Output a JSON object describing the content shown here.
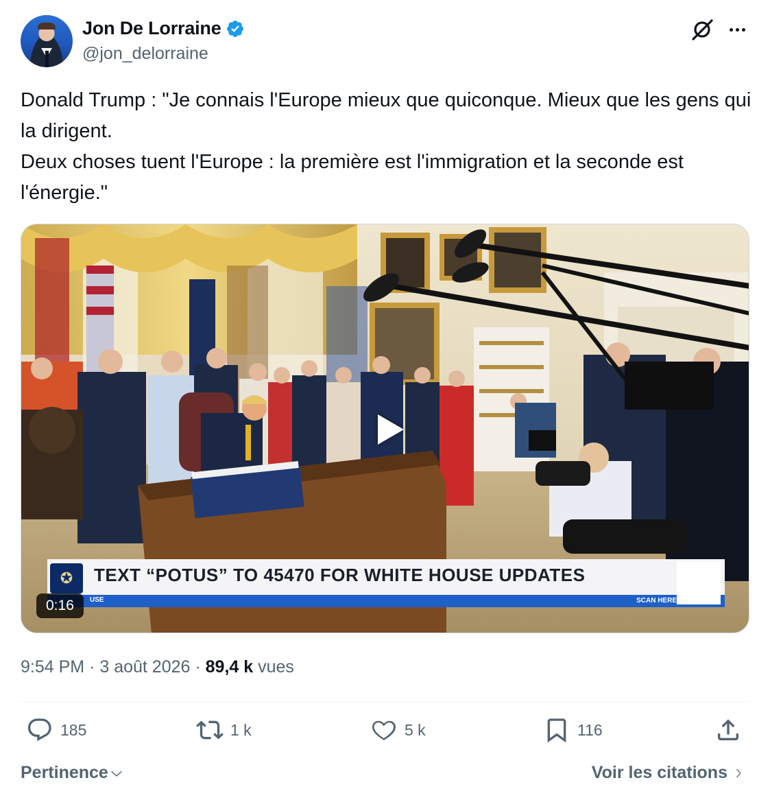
{
  "author": {
    "display_name": "Jon De Lorraine",
    "handle": "@jon_delorraine",
    "verified": true
  },
  "tweet": {
    "text": "Donald Trump : \"Je connais l'Europe mieux que quiconque. Mieux que les gens qui la dirigent.\nDeux choses tuent l'Europe : la première est l'immigration et la seconde est l'énergie.\""
  },
  "media": {
    "type": "video",
    "duration": "0:16",
    "chyron_text": "TEXT “POTUS” TO 45470 FOR WHITE HOUSE UPDATES",
    "chyron_bar_left": "USE",
    "chyron_bar_right": "SCAN HERE"
  },
  "meta": {
    "time": "9:54 PM",
    "separator": "·",
    "date": "3 août 2026",
    "views_count": "89,4 k",
    "views_label": "vues"
  },
  "actions": {
    "replies": "185",
    "reposts": "1 k",
    "likes": "5 k",
    "bookmarks": "116"
  },
  "footer": {
    "sort_label": "Pertinence",
    "quotes_label": "Voir les citations"
  },
  "colors": {
    "text_primary": "#0f1419",
    "text_secondary": "#536471",
    "verified_blue": "#1d9bf0",
    "chyron_blue": "#1f5fc8"
  },
  "icons": {
    "verified": "verified-badge-icon",
    "grok": "grok-icon",
    "more": "more-icon",
    "reply": "reply-icon",
    "repost": "repost-icon",
    "like": "like-icon",
    "bookmark": "bookmark-icon",
    "share": "share-icon"
  }
}
